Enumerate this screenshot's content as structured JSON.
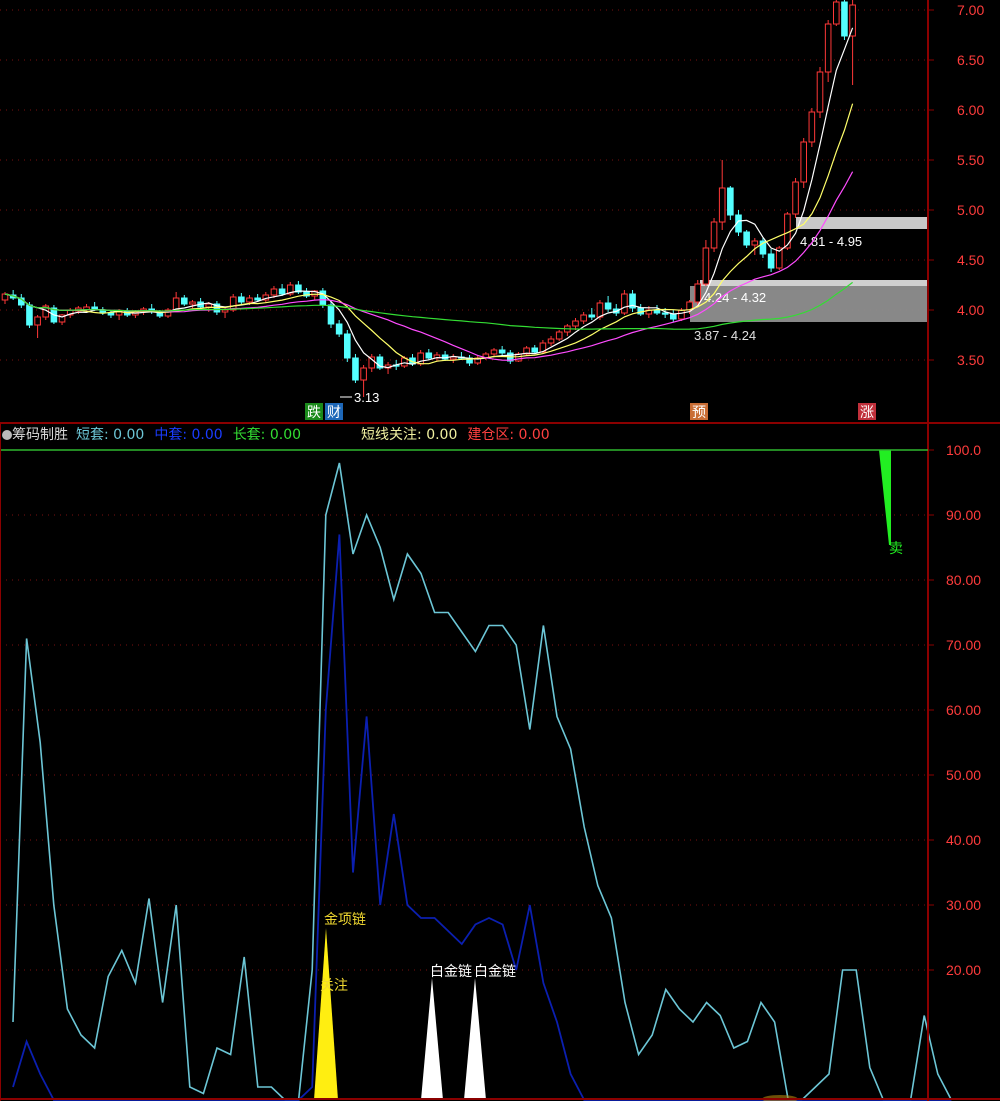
{
  "colors": {
    "background": "#000000",
    "frame": "#8b0000",
    "axis_text": "#ff3c3c",
    "up": "#ff3838",
    "down": "#54ffff",
    "ma5": "#ffffff",
    "ma10": "#ffff6a",
    "ma20": "#ff4cff",
    "ma60": "#33dd33",
    "short_line": "#6cc6d6",
    "mid_line": "#0b1fb0",
    "gold": "#ffee11",
    "white_spike": "#ffffff",
    "green_bar": "#22ee22"
  },
  "price_panel": {
    "y_ticks": [
      "7.00",
      "6.50",
      "6.00",
      "5.50",
      "5.00",
      "4.50",
      "4.00",
      "3.50"
    ],
    "markers": [
      {
        "text": "跌",
        "bg": "#1b8a1b"
      },
      {
        "text": "财",
        "bg": "#1d67b8"
      },
      {
        "text": "预",
        "bg": "#c96d34"
      },
      {
        "text": "涨",
        "bg": "#c0303b"
      }
    ],
    "chip_zones": [
      {
        "label": "4.81 - 4.95",
        "low": 4.81,
        "high": 4.95
      },
      {
        "label": "4.24 - 4.32",
        "low": 4.24,
        "high": 4.32
      },
      {
        "label": "3.87 - 4.24",
        "low": 3.87,
        "high": 4.24
      }
    ],
    "low_price_label": "3.13"
  },
  "indicator_panel": {
    "name": "筹码制胜",
    "metrics": [
      {
        "label": "短套",
        "value": "0.00",
        "color": "#6cc6d6"
      },
      {
        "label": "中套",
        "value": "0.00",
        "color": "#1a3cff"
      },
      {
        "label": "长套",
        "value": "0.00",
        "color": "#33dd33"
      },
      {
        "label": "短线关注",
        "value": "0.00",
        "color": "#f0f0a0"
      },
      {
        "label": "建仓区",
        "value": "0.00",
        "color": "#ff4040"
      }
    ],
    "y_ticks": [
      "100.0",
      "90.00",
      "80.00",
      "70.00",
      "60.00",
      "50.00",
      "40.00",
      "30.00",
      "20.00"
    ],
    "signal_labels": {
      "gold": "金项链",
      "attention": "关注",
      "white1": "白金链",
      "white2": "白金链",
      "sell": "卖"
    }
  },
  "chart_data": [
    {
      "type": "candlestick",
      "note_ma": "moving averages MA5 / MA10 / MA20 / MA60 drawn from closes",
      "ylim": [
        3.0,
        7.1
      ],
      "ohlc": [
        [
          4.1,
          4.18,
          4.06,
          4.16
        ],
        [
          4.15,
          4.2,
          4.1,
          4.12
        ],
        [
          4.12,
          4.16,
          4.02,
          4.05
        ],
        [
          4.05,
          4.08,
          3.82,
          3.85
        ],
        [
          3.85,
          3.95,
          3.72,
          3.93
        ],
        [
          3.93,
          4.06,
          3.9,
          4.04
        ],
        [
          4.02,
          4.05,
          3.86,
          3.88
        ],
        [
          3.88,
          3.96,
          3.85,
          3.95
        ],
        [
          3.95,
          4.02,
          3.92,
          4.0
        ],
        [
          3.99,
          4.04,
          3.96,
          4.02
        ],
        [
          4.0,
          4.06,
          3.98,
          4.03
        ],
        [
          4.03,
          4.08,
          3.99,
          4.0
        ],
        [
          4.0,
          4.03,
          3.95,
          3.97
        ],
        [
          3.97,
          4.0,
          3.92,
          3.95
        ],
        [
          3.95,
          4.01,
          3.9,
          3.99
        ],
        [
          3.99,
          4.02,
          3.93,
          3.95
        ],
        [
          3.95,
          4.0,
          3.92,
          3.98
        ],
        [
          3.98,
          4.03,
          3.95,
          4.01
        ],
        [
          4.01,
          4.06,
          3.96,
          3.98
        ],
        [
          3.98,
          4.0,
          3.92,
          3.94
        ],
        [
          3.94,
          4.02,
          3.92,
          4.0
        ],
        [
          4.0,
          4.18,
          3.98,
          4.12
        ],
        [
          4.12,
          4.15,
          4.04,
          4.06
        ],
        [
          4.06,
          4.1,
          4.02,
          4.08
        ],
        [
          4.08,
          4.12,
          4.01,
          4.03
        ],
        [
          4.03,
          4.08,
          3.98,
          4.06
        ],
        [
          4.06,
          4.09,
          3.95,
          3.98
        ],
        [
          3.98,
          4.03,
          3.92,
          4.0
        ],
        [
          4.0,
          4.16,
          3.98,
          4.13
        ],
        [
          4.13,
          4.17,
          4.06,
          4.08
        ],
        [
          4.08,
          4.15,
          4.05,
          4.12
        ],
        [
          4.12,
          4.16,
          4.08,
          4.1
        ],
        [
          4.1,
          4.18,
          4.07,
          4.15
        ],
        [
          4.15,
          4.24,
          4.12,
          4.21
        ],
        [
          4.21,
          4.26,
          4.14,
          4.16
        ],
        [
          4.16,
          4.28,
          4.14,
          4.25
        ],
        [
          4.25,
          4.29,
          4.16,
          4.18
        ],
        [
          4.18,
          4.22,
          4.12,
          4.14
        ],
        [
          4.14,
          4.2,
          4.1,
          4.19
        ],
        [
          4.19,
          4.22,
          4.02,
          4.05
        ],
        [
          4.05,
          4.08,
          3.82,
          3.86
        ],
        [
          3.86,
          3.9,
          3.73,
          3.76
        ],
        [
          3.76,
          3.8,
          3.48,
          3.52
        ],
        [
          3.52,
          3.56,
          3.27,
          3.3
        ],
        [
          3.3,
          3.45,
          3.13,
          3.42
        ],
        [
          3.42,
          3.56,
          3.38,
          3.53
        ],
        [
          3.53,
          3.56,
          3.4,
          3.42
        ],
        [
          3.42,
          3.48,
          3.36,
          3.45
        ],
        [
          3.45,
          3.5,
          3.4,
          3.44
        ],
        [
          3.44,
          3.54,
          3.42,
          3.52
        ],
        [
          3.52,
          3.56,
          3.44,
          3.46
        ],
        [
          3.46,
          3.6,
          3.44,
          3.57
        ],
        [
          3.57,
          3.61,
          3.5,
          3.52
        ],
        [
          3.52,
          3.58,
          3.49,
          3.55
        ],
        [
          3.55,
          3.59,
          3.49,
          3.51
        ],
        [
          3.51,
          3.56,
          3.47,
          3.53
        ],
        [
          3.53,
          3.58,
          3.5,
          3.52
        ],
        [
          3.52,
          3.55,
          3.44,
          3.47
        ],
        [
          3.47,
          3.54,
          3.45,
          3.52
        ],
        [
          3.52,
          3.58,
          3.5,
          3.56
        ],
        [
          3.56,
          3.62,
          3.53,
          3.6
        ],
        [
          3.6,
          3.64,
          3.54,
          3.57
        ],
        [
          3.57,
          3.6,
          3.46,
          3.49
        ],
        [
          3.49,
          3.58,
          3.48,
          3.56
        ],
        [
          3.56,
          3.64,
          3.54,
          3.62
        ],
        [
          3.62,
          3.65,
          3.56,
          3.58
        ],
        [
          3.58,
          3.7,
          3.56,
          3.67
        ],
        [
          3.67,
          3.74,
          3.64,
          3.71
        ],
        [
          3.71,
          3.8,
          3.69,
          3.78
        ],
        [
          3.78,
          3.86,
          3.74,
          3.84
        ],
        [
          3.84,
          3.92,
          3.8,
          3.89
        ],
        [
          3.89,
          3.98,
          3.86,
          3.95
        ],
        [
          3.95,
          4.02,
          3.9,
          3.93
        ],
        [
          3.93,
          4.1,
          3.9,
          4.07
        ],
        [
          4.07,
          4.14,
          3.98,
          4.01
        ],
        [
          4.01,
          4.06,
          3.94,
          3.97
        ],
        [
          3.97,
          4.2,
          3.95,
          4.16
        ],
        [
          4.16,
          4.2,
          3.98,
          4.02
        ],
        [
          4.02,
          4.06,
          3.94,
          3.96
        ],
        [
          3.96,
          4.04,
          3.92,
          4.0
        ],
        [
          4.0,
          4.05,
          3.95,
          3.97
        ],
        [
          3.97,
          4.02,
          3.92,
          3.96
        ],
        [
          3.96,
          4.0,
          3.88,
          3.91
        ],
        [
          3.91,
          4.02,
          3.89,
          4.0
        ],
        [
          4.0,
          4.1,
          3.96,
          4.08
        ],
        [
          4.08,
          4.3,
          4.05,
          4.26
        ],
        [
          4.26,
          4.7,
          4.24,
          4.62
        ],
        [
          4.62,
          4.92,
          4.58,
          4.88
        ],
        [
          4.88,
          5.5,
          4.8,
          5.22
        ],
        [
          5.22,
          5.24,
          4.9,
          4.95
        ],
        [
          4.95,
          5.0,
          4.74,
          4.78
        ],
        [
          4.78,
          4.8,
          4.62,
          4.65
        ],
        [
          4.65,
          4.72,
          4.55,
          4.69
        ],
        [
          4.69,
          4.72,
          4.52,
          4.56
        ],
        [
          4.56,
          4.61,
          4.38,
          4.42
        ],
        [
          4.42,
          4.64,
          4.4,
          4.62
        ],
        [
          4.62,
          4.98,
          4.6,
          4.96
        ],
        [
          4.96,
          5.32,
          4.92,
          5.28
        ],
        [
          5.28,
          5.72,
          5.22,
          5.68
        ],
        [
          5.68,
          6.02,
          5.63,
          5.98
        ],
        [
          5.98,
          6.43,
          5.92,
          6.38
        ],
        [
          6.38,
          6.9,
          6.28,
          6.86
        ],
        [
          6.86,
          7.12,
          6.84,
          7.08
        ],
        [
          7.08,
          7.12,
          6.7,
          6.74
        ],
        [
          6.74,
          7.1,
          6.25,
          7.05
        ]
      ]
    },
    {
      "type": "line",
      "ylim": [
        0,
        100
      ],
      "series": [
        {
          "name": "短套",
          "values": [
            12,
            71,
            55,
            30,
            14,
            10,
            8,
            19,
            23,
            18,
            31,
            15,
            30,
            2,
            1,
            8,
            7,
            22,
            2,
            2,
            0,
            0,
            20,
            90,
            98,
            84,
            90,
            85,
            77,
            84,
            81,
            75,
            75,
            72,
            69,
            73,
            73,
            70,
            57,
            73,
            59,
            54,
            42,
            33,
            28,
            15,
            7,
            10,
            17,
            14,
            12,
            15,
            13,
            8,
            9,
            15,
            12,
            0,
            0,
            2,
            4,
            20,
            20,
            5,
            0,
            0,
            0,
            13,
            4,
            0
          ]
        },
        {
          "name": "中套",
          "values": [
            2,
            9,
            4,
            0,
            0,
            0,
            0,
            0,
            0,
            0,
            0,
            0,
            0,
            0,
            0,
            0,
            0,
            0,
            0,
            0,
            0,
            0,
            2,
            60,
            87,
            35,
            59,
            30,
            44,
            30,
            28,
            28,
            26,
            24,
            27,
            28,
            27,
            20,
            30,
            18,
            12,
            4,
            0,
            0,
            0,
            0,
            0,
            0,
            0,
            0,
            0,
            0,
            0,
            0,
            0,
            0,
            0,
            0,
            0,
            0,
            0,
            0,
            0,
            0,
            0,
            0,
            0,
            0,
            0,
            0
          ]
        }
      ]
    }
  ]
}
